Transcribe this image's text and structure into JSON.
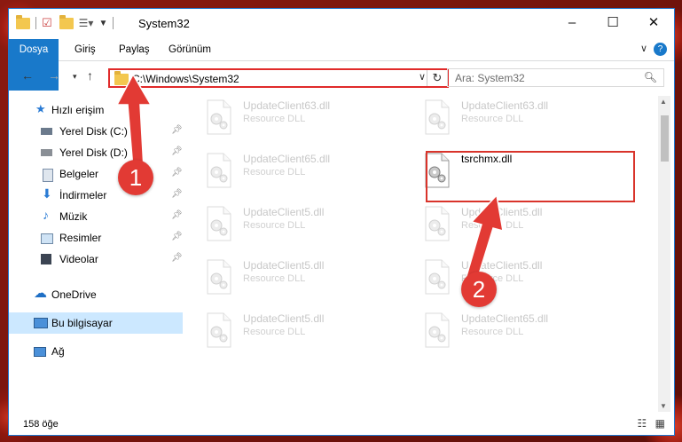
{
  "window": {
    "title": "System32",
    "controls": [
      "minimize-icon",
      "maximize-icon",
      "close-icon"
    ]
  },
  "ribbon": {
    "tabs": [
      {
        "label": "Dosya",
        "active": true
      },
      {
        "label": "Giriş"
      },
      {
        "label": "Paylaş"
      },
      {
        "label": "Görünüm"
      }
    ],
    "help": "?"
  },
  "address": {
    "path": "C:\\Windows\\System32",
    "search_placeholder": "Ara: System32"
  },
  "nav": {
    "items": [
      {
        "label": "Hızlı erişim",
        "icon": "star-icon",
        "pinned": false
      },
      {
        "label": "Yerel Disk (C:)",
        "icon": "drive-icon",
        "pinned": true
      },
      {
        "label": "Yerel Disk (D:)",
        "icon": "drive-icon",
        "pinned": true
      },
      {
        "label": "Belgeler",
        "icon": "documents-icon",
        "pinned": true
      },
      {
        "label": "İndirmeler",
        "icon": "download-icon",
        "pinned": true
      },
      {
        "label": "Müzik",
        "icon": "music-icon",
        "pinned": true
      },
      {
        "label": "Resimler",
        "icon": "pictures-icon",
        "pinned": true
      },
      {
        "label": "Videolar",
        "icon": "video-icon",
        "pinned": true
      },
      {
        "label": "OneDrive",
        "icon": "cloud-icon",
        "pinned": false
      },
      {
        "label": "Bu bilgisayar",
        "icon": "computer-icon",
        "pinned": false,
        "selected": true
      },
      {
        "label": "Ağ",
        "icon": "network-icon",
        "pinned": false
      }
    ]
  },
  "files": [
    {
      "name": "UpdateClient63.dll",
      "desc": "Resource DLL",
      "faded": true
    },
    {
      "name": "UpdateClient63.dll",
      "desc": "Resource DLL",
      "faded": true
    },
    {
      "name": "UpdateClient65.dll",
      "desc": "Resource DLL",
      "faded": true
    },
    {
      "name": "tsrchmx.dll",
      "desc": "",
      "faded": false,
      "highlighted": true
    },
    {
      "name": "UpdateClient5.dll",
      "desc": "Resource DLL",
      "faded": true
    },
    {
      "name": "UpdateClient5.dll",
      "desc": "Resource DLL",
      "faded": true
    },
    {
      "name": "UpdateClient5.dll",
      "desc": "Resource DLL",
      "faded": true
    },
    {
      "name": "UpdateClient5.dll",
      "desc": "Resource DLL",
      "faded": true
    },
    {
      "name": "UpdateClient5.dll",
      "desc": "Resource DLL",
      "faded": true
    },
    {
      "name": "UpdateClient65.dll",
      "desc": "Resource DLL",
      "faded": true
    }
  ],
  "status": {
    "count": "158 öğe"
  },
  "annotations": {
    "badge1": "1",
    "badge2": "2",
    "color": "#e23a34"
  }
}
